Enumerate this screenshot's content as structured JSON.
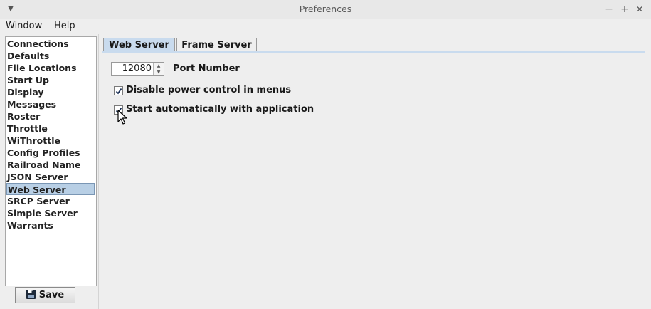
{
  "window": {
    "title": "Preferences",
    "menu_icon": "chevron-down-icon",
    "minimize_label": "−",
    "maximize_label": "+",
    "close_label": "✕"
  },
  "menubar": {
    "items": [
      {
        "label": "Window"
      },
      {
        "label": "Help"
      }
    ]
  },
  "sidebar": {
    "items": [
      {
        "label": "Connections"
      },
      {
        "label": "Defaults"
      },
      {
        "label": "File Locations"
      },
      {
        "label": "Start Up"
      },
      {
        "label": "Display"
      },
      {
        "label": "Messages"
      },
      {
        "label": "Roster"
      },
      {
        "label": "Throttle"
      },
      {
        "label": "WiThrottle"
      },
      {
        "label": "Config Profiles"
      },
      {
        "label": "Railroad Name"
      },
      {
        "label": "JSON Server"
      },
      {
        "label": "Web Server"
      },
      {
        "label": "SRCP Server"
      },
      {
        "label": "Simple Server"
      },
      {
        "label": "Warrants"
      }
    ],
    "selected": "Web Server",
    "save_label": "Save",
    "save_icon": "floppy-disk-icon"
  },
  "tabs": [
    {
      "label": "Web Server"
    },
    {
      "label": "Frame Server"
    }
  ],
  "active_tab": "Web Server",
  "web_server": {
    "port_value": "12080",
    "port_label": "Port Number",
    "disable_power_label": "Disable power control in menus",
    "disable_power_checked": true,
    "start_auto_label": "Start automatically with application",
    "start_auto_checked": true
  },
  "colors": {
    "selection": "#b8cfe5",
    "active_tab": "#c9dbee",
    "background": "#eeeeee"
  }
}
